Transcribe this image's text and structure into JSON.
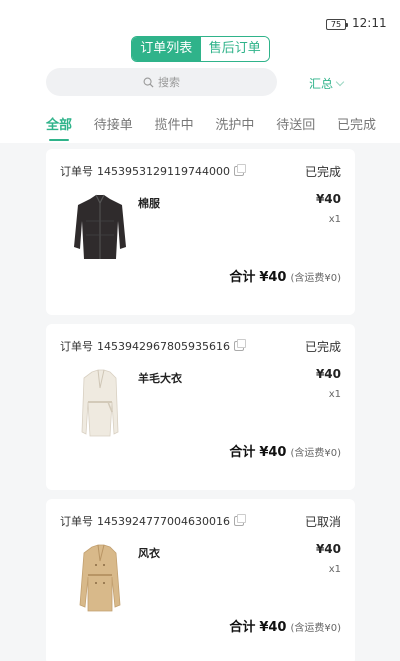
{
  "status_bar": {
    "battery": "75",
    "time": "12:11"
  },
  "segment": {
    "tabs": [
      "订单列表",
      "售后订单"
    ],
    "active": 0
  },
  "search": {
    "placeholder": "搜索",
    "icon": "search-icon"
  },
  "summary": {
    "label": "汇总",
    "icon": "chevron-down-icon"
  },
  "tabs": [
    "全部",
    "待接单",
    "揽件中",
    "洗护中",
    "待送回",
    "已完成"
  ],
  "active_tab": "全部",
  "accent_color": "#2fb38a",
  "orders": [
    {
      "order_label": "订单号",
      "order_no": "1453953129119744000",
      "status": "已完成",
      "item_name": "棉服",
      "price": "¥40",
      "qty": "x1",
      "total_label": "合计",
      "total": "¥40",
      "shipping_note": "(含运费¥0)"
    },
    {
      "order_label": "订单号",
      "order_no": "1453942967805935616",
      "status": "已完成",
      "item_name": "羊毛大衣",
      "price": "¥40",
      "qty": "x1",
      "total_label": "合计",
      "total": "¥40",
      "shipping_note": "(含运费¥0)"
    },
    {
      "order_label": "订单号",
      "order_no": "1453924777004630016",
      "status": "已取消",
      "item_name": "风衣",
      "price": "¥40",
      "qty": "x1",
      "total_label": "合计",
      "total": "¥40",
      "shipping_note": "(含运费¥0)"
    }
  ]
}
